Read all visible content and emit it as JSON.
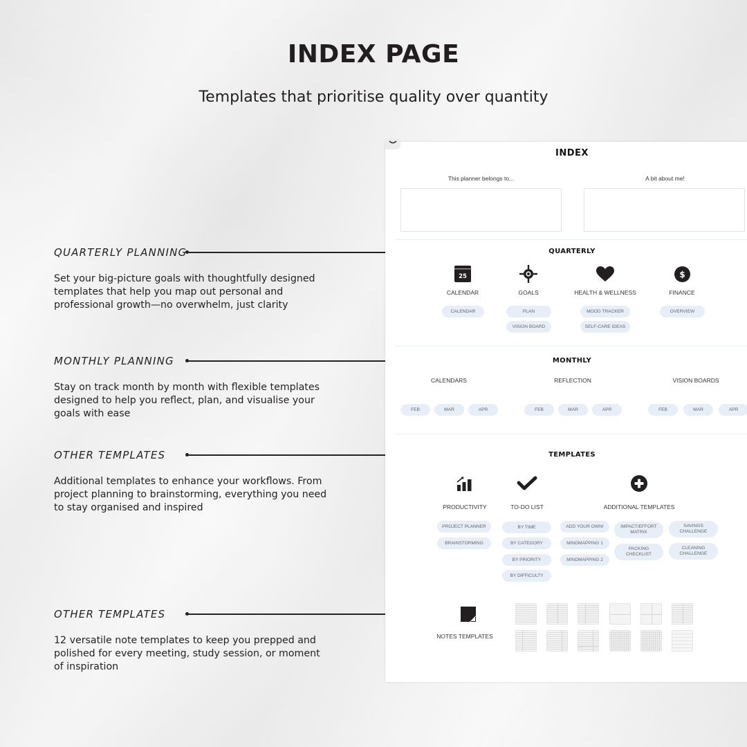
{
  "header": {
    "title": "INDEX PAGE",
    "subtitle": "Templates that prioritise quality over quantity"
  },
  "features": [
    {
      "title": "QUARTERLY PLANNING",
      "description": "Set your big-picture goals with  thoughtfully designed templates that help you map out personal and professional growth—no overwhelm, just clarity"
    },
    {
      "title": "MONTHLY PLANNING",
      "description": "Stay on track month by month with  flexible templates designed to help you reflect, plan, and visualise your goals with ease"
    },
    {
      "title": "OTHER TEMPLATES",
      "description": "Additional templates to enhance your workflows. From project planning to brainstorming, everything you need to stay organised and inspired"
    },
    {
      "title": "OTHER TEMPLATES",
      "description": "12 versatile note templates to keep you prepped and polished for every meeting, study session, or moment of inspiration"
    }
  ],
  "planner": {
    "title": "INDEX",
    "belongs_label": "This planner belongs to...",
    "about_label": "A bit about me!",
    "belongs_value": "",
    "about_value": "",
    "quarterly": {
      "title": "QUARTERLY",
      "categories": [
        {
          "label": "CALENDAR",
          "icon": "calendar-icon",
          "icon_text": "25",
          "links": [
            "CALENDAR"
          ]
        },
        {
          "label": "GOALS",
          "icon": "target-icon",
          "links": [
            "PLAN",
            "VISION BOARD"
          ]
        },
        {
          "label": "HEALTH & WELLNESS",
          "icon": "heart-icon",
          "links": [
            "MOOD TRACKER",
            "SELF-CARE IDEAS"
          ]
        },
        {
          "label": "FINANCE",
          "icon": "dollar-icon",
          "icon_text": "$",
          "links": [
            "OVERVIEW"
          ]
        }
      ]
    },
    "monthly": {
      "title": "MONTHLY",
      "categories": [
        {
          "label": "CALENDARS",
          "links": [
            "FEB",
            "MAR",
            "APR"
          ]
        },
        {
          "label": "REFLECTION",
          "links": [
            "FEB",
            "MAR",
            "APR"
          ]
        },
        {
          "label": "VISION BOARDS",
          "links": [
            "FEB",
            "MAR",
            "APR"
          ]
        }
      ]
    },
    "templates": {
      "title": "TEMPLATES",
      "categories": [
        {
          "label": "PRODUCTIVITY",
          "icon": "bar-chart-icon",
          "links": [
            "PROJECT PLANNER",
            "BRAINSTORMING"
          ]
        },
        {
          "label": "TO-DO LIST",
          "icon": "checkmark-icon",
          "links": [
            "BY TIME",
            "BY CATEGORY",
            "BY PRIORITY",
            "BY DIFFICULTY"
          ]
        },
        {
          "label": "ADDITIONAL TEMPLATES",
          "icon": "plus-circle-icon",
          "links": [
            "ADD YOUR OWN!",
            "MINDMAPPING 1",
            "MINDMAPPING 2",
            "IMPACT/EFFORT\nMATRIX",
            "PACKING\nCHECKLIST",
            "SAVINGS\nCHALLENGE",
            "CLEANING\nCHALLENGE"
          ]
        }
      ]
    },
    "notes": {
      "label": "NOTES TEMPLATES",
      "icon": "note-icon",
      "count": 12
    }
  }
}
